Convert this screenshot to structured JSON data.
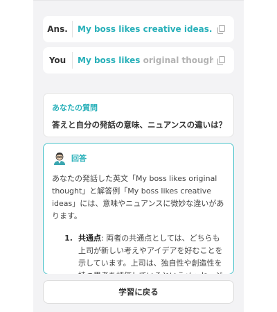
{
  "answer_row": {
    "label": "Ans.",
    "text_highlight": "My boss likes creative ideas.",
    "text_rest": "",
    "copy_icon": "copy-icon"
  },
  "you_row": {
    "label": "You",
    "text_highlight": "My boss likes",
    "text_rest": " original thought.",
    "copy_icon": "copy-icon"
  },
  "question": {
    "title": "あなたの質問",
    "text": "答えと自分の発話の意味、ニュアンスの違いは？"
  },
  "answer": {
    "title": "回答",
    "avatar_icon": "teacher-avatar-icon",
    "intro": "あなたの発話した英文「My boss likes original thought」と解答例「My boss likes creative ideas」には、意味やニュアンスに微妙な違いがあります。",
    "points": [
      {
        "number": "1.",
        "heading": "共通点",
        "text": ": 両者の共通点としては、どちらも上司が新しい考えやアイデアを好むことを示しています。上司は、独自性や創造性を持つ思考を評価しているというメッセージが伝わります。"
      }
    ]
  },
  "footer": {
    "back_label": "学習に戻る"
  },
  "colors": {
    "accent": "#28b0b9",
    "muted": "#b3b3b3",
    "panel_bg": "#f3f3f5"
  }
}
